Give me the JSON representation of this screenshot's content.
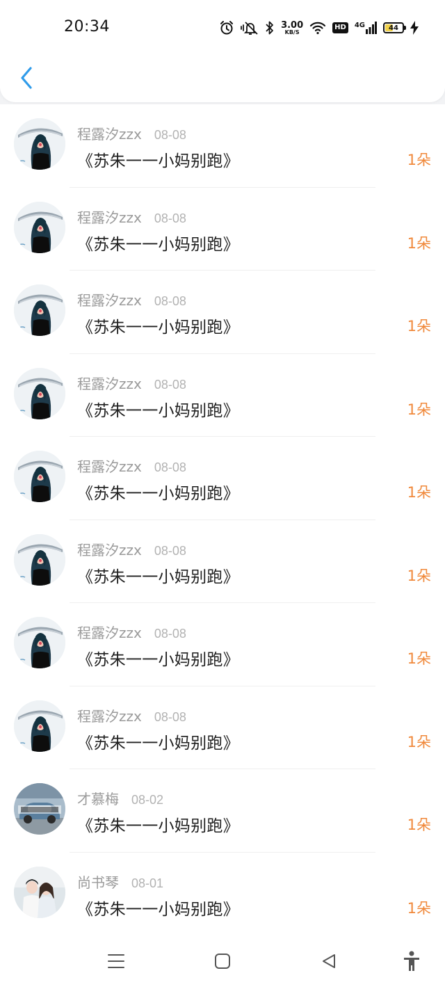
{
  "status_bar": {
    "time": "20:34",
    "net_speed_value": "3.00",
    "net_speed_unit": "KB/S",
    "hd_label": "HD",
    "network_type": "4G",
    "battery_level": "44",
    "battery_fraction": 0.44,
    "icons": [
      "alarm-icon",
      "mute-icon",
      "bluetooth-icon",
      "wifi-icon",
      "signal-icon",
      "battery-icon",
      "charging-icon"
    ]
  },
  "header": {
    "back_icon": "chevron-left-icon",
    "accent_color": "#2f9bea"
  },
  "records": [
    {
      "name": "程露汐zzx",
      "date": "08-08",
      "gift": "《苏朱一一小妈别跑》",
      "count": "1朵",
      "avatar": "woman-umbrella"
    },
    {
      "name": "程露汐zzx",
      "date": "08-08",
      "gift": "《苏朱一一小妈别跑》",
      "count": "1朵",
      "avatar": "woman-umbrella"
    },
    {
      "name": "程露汐zzx",
      "date": "08-08",
      "gift": "《苏朱一一小妈别跑》",
      "count": "1朵",
      "avatar": "woman-umbrella"
    },
    {
      "name": "程露汐zzx",
      "date": "08-08",
      "gift": "《苏朱一一小妈别跑》",
      "count": "1朵",
      "avatar": "woman-umbrella"
    },
    {
      "name": "程露汐zzx",
      "date": "08-08",
      "gift": "《苏朱一一小妈别跑》",
      "count": "1朵",
      "avatar": "woman-umbrella"
    },
    {
      "name": "程露汐zzx",
      "date": "08-08",
      "gift": "《苏朱一一小妈别跑》",
      "count": "1朵",
      "avatar": "woman-umbrella"
    },
    {
      "name": "程露汐zzx",
      "date": "08-08",
      "gift": "《苏朱一一小妈别跑》",
      "count": "1朵",
      "avatar": "woman-umbrella"
    },
    {
      "name": "程露汐zzx",
      "date": "08-08",
      "gift": "《苏朱一一小妈别跑》",
      "count": "1朵",
      "avatar": "woman-umbrella"
    },
    {
      "name": "才慕梅",
      "date": "08-02",
      "gift": "《苏朱一一小妈别跑》",
      "count": "1朵",
      "avatar": "blue-car"
    },
    {
      "name": "尚书琴",
      "date": "08-01",
      "gift": "《苏朱一一小妈别跑》",
      "count": "1朵",
      "avatar": "couple"
    }
  ],
  "colors": {
    "gift_count": "#f0883a",
    "name_text": "#9a9a9a",
    "title_text": "#1f1f1f"
  },
  "nav_bar": {
    "icons": [
      "menu-icon",
      "home-square-icon",
      "back-triangle-icon",
      "accessibility-icon"
    ]
  }
}
